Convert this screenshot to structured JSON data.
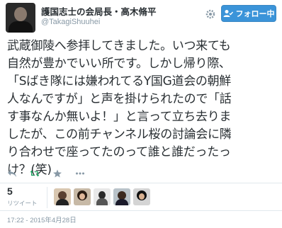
{
  "header": {
    "display_name": "護国志士の会局長・高木脩平",
    "handle": "@TakagiShuuhei",
    "follow_label": "フォロー中"
  },
  "tweet": {
    "lines": [
      "武蔵御陵へ参拝してきました。いつ来ても",
      "自然が豊かでいい所です。しかし帰り際、",
      "「Sばき隊には嫌われてるY国G道会の朝鮮",
      "人なんですが」と声を掛けられたので「話",
      "す事なんか無いよ！」と言って立ち去りま",
      "したが、この前チャンネル桜の討論会に隣",
      "り合わせで座ってたのって誰と誰だったっ",
      "け？(笑)"
    ]
  },
  "stats": {
    "retweet_count": "5",
    "retweet_label": "リツイート"
  },
  "timestamp": "17:22 - 2015年4月28日"
}
